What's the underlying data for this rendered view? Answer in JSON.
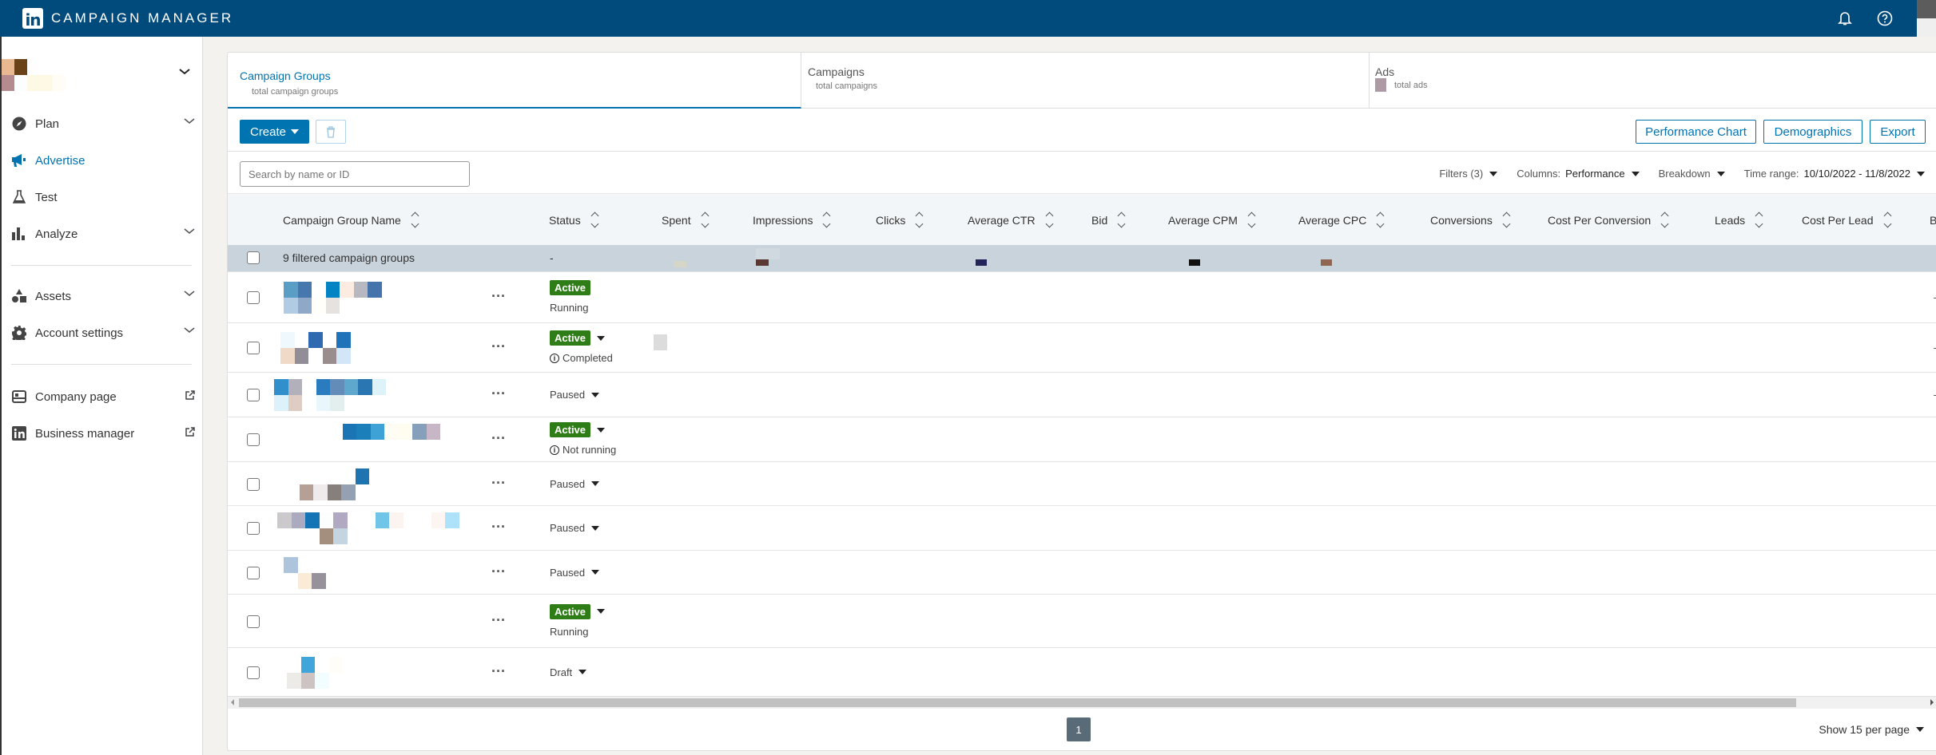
{
  "app": {
    "title": "CAMPAIGN MANAGER",
    "logo": "in"
  },
  "topbar": {
    "icons": [
      "bell-icon",
      "help-icon"
    ]
  },
  "sidebar": {
    "items": [
      {
        "label": "Plan",
        "icon": "compass-icon",
        "expandable": true
      },
      {
        "label": "Advertise",
        "icon": "megaphone-icon",
        "active": true
      },
      {
        "label": "Test",
        "icon": "flask-icon"
      },
      {
        "label": "Analyze",
        "icon": "bar-chart-icon",
        "expandable": true
      },
      {
        "label": "Assets",
        "icon": "shapes-icon",
        "expandable": true
      },
      {
        "label": "Account settings",
        "icon": "gear-icon",
        "expandable": true
      },
      {
        "label": "Company page",
        "icon": "company-page-icon",
        "external": true
      },
      {
        "label": "Business manager",
        "icon": "linkedin-icon",
        "external": true
      }
    ]
  },
  "tabs": [
    {
      "label": "Campaign Groups",
      "sub": "total campaign groups",
      "active": true
    },
    {
      "label": "Campaigns",
      "sub": "total campaigns"
    },
    {
      "label": "Ads",
      "sub": "total ads"
    }
  ],
  "toolbar": {
    "create_label": "Create",
    "performance_chart_label": "Performance Chart",
    "demographics_label": "Demographics",
    "export_label": "Export"
  },
  "search": {
    "placeholder": "Search by name or ID"
  },
  "filters": {
    "filters_label": "Filters (3)",
    "columns_label": "Columns:",
    "columns_value": "Performance",
    "breakdown_label": "Breakdown",
    "time_range_label": "Time range:",
    "time_range_value": "10/10/2022 - 11/8/2022"
  },
  "table": {
    "columns": [
      "Campaign Group Name",
      "Status",
      "Spent",
      "Impressions",
      "Clicks",
      "Average CTR",
      "Bid",
      "Average CPM",
      "Average CPC",
      "Conversions",
      "Cost Per Conversion",
      "Leads",
      "Cost Per Lead",
      "B"
    ],
    "summary": {
      "label": "9 filtered campaign groups",
      "status": "-"
    },
    "rows": [
      {
        "status": "Active",
        "dropdown": false,
        "sub": "Running",
        "sub_info": false,
        "last": "-"
      },
      {
        "status": "Active",
        "dropdown": true,
        "sub": "Completed",
        "sub_info": true,
        "last": "-"
      },
      {
        "status": "Paused",
        "dropdown": true,
        "sub": "",
        "sub_info": false,
        "last": "-"
      },
      {
        "status": "Active",
        "dropdown": true,
        "sub": "Not running",
        "sub_info": true,
        "last": ""
      },
      {
        "status": "Paused",
        "dropdown": true,
        "sub": "",
        "sub_info": false,
        "last": ""
      },
      {
        "status": "Paused",
        "dropdown": true,
        "sub": "",
        "sub_info": false,
        "last": ""
      },
      {
        "status": "Paused",
        "dropdown": true,
        "sub": "",
        "sub_info": false,
        "last": ""
      },
      {
        "status": "Active",
        "dropdown": true,
        "sub": "Running",
        "sub_info": false,
        "last": ""
      },
      {
        "status": "Draft",
        "dropdown": true,
        "sub": "",
        "sub_info": false,
        "last": ""
      }
    ]
  },
  "pagination": {
    "current_page": "1",
    "per_page_label": "Show 15 per page"
  }
}
